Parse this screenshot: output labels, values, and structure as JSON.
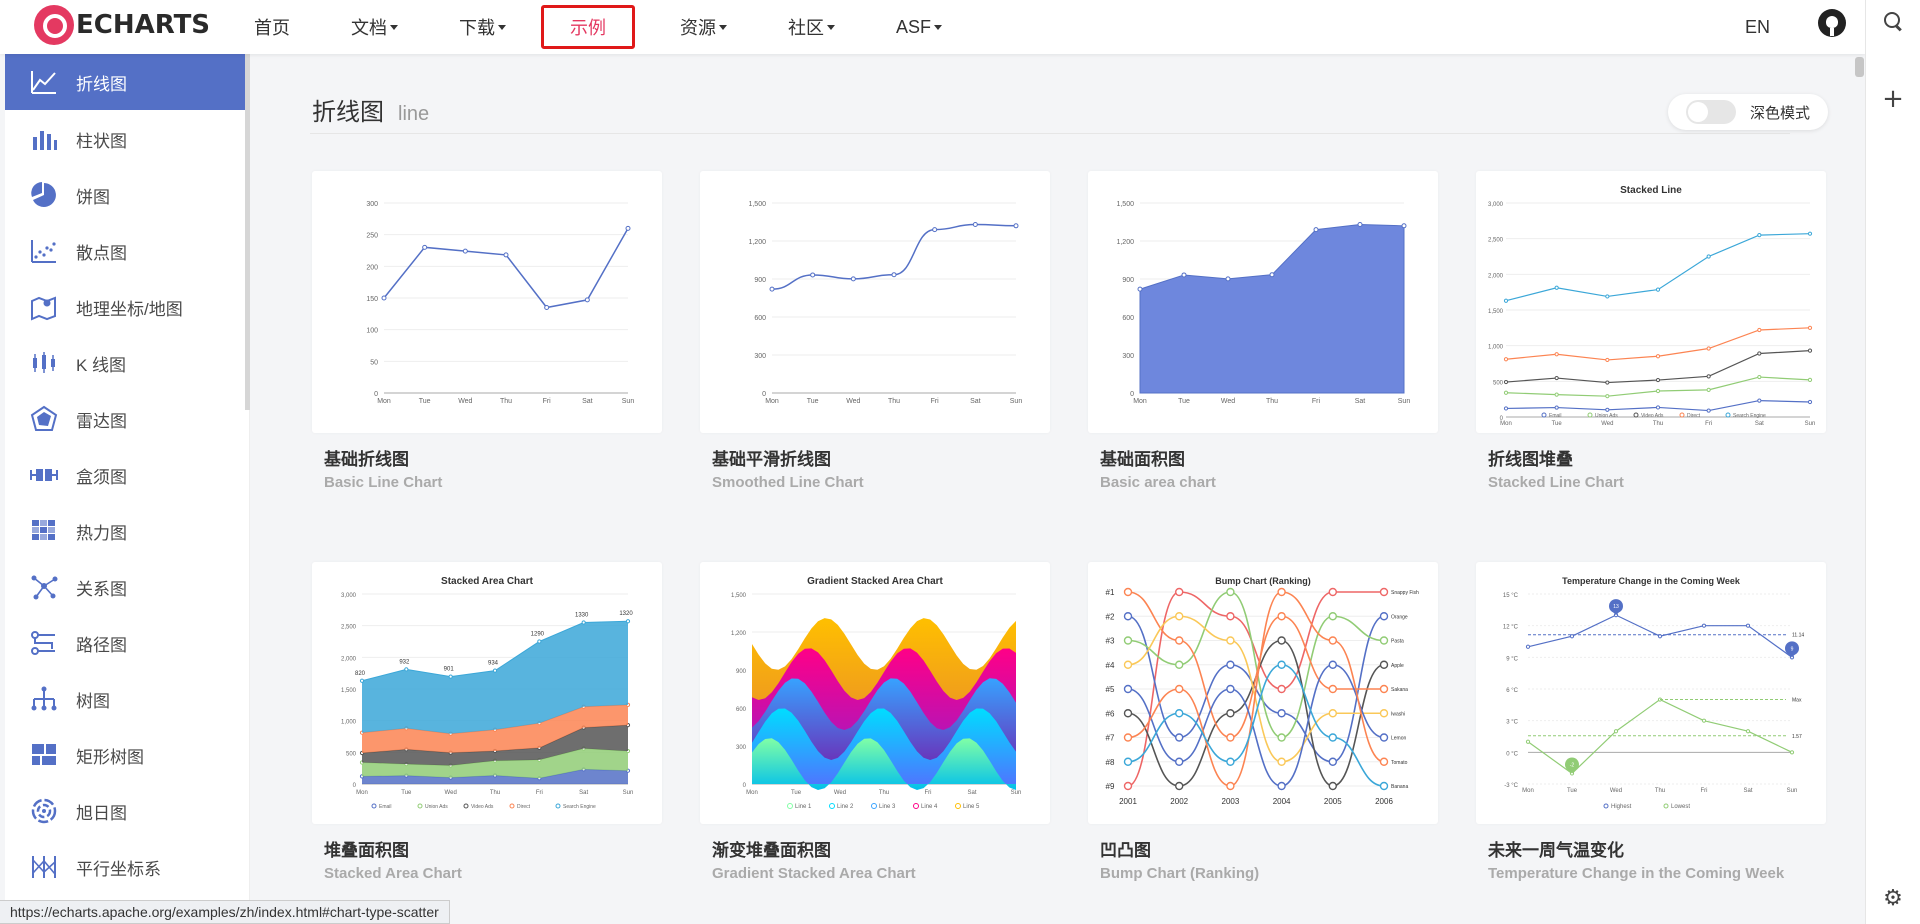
{
  "nav": {
    "logo_text": "ECHARTS",
    "items": [
      {
        "label": "首页",
        "caret": false
      },
      {
        "label": "文档",
        "caret": true
      },
      {
        "label": "下载",
        "caret": true
      },
      {
        "label": "示例",
        "caret": false,
        "active": true
      },
      {
        "label": "资源",
        "caret": true
      },
      {
        "label": "社区",
        "caret": true
      },
      {
        "label": "ASF",
        "caret": true
      }
    ],
    "lang": "EN"
  },
  "sidebar": {
    "items": [
      {
        "label": "折线图",
        "icon": "line-chart-icon",
        "active": true
      },
      {
        "label": "柱状图",
        "icon": "bar-chart-icon"
      },
      {
        "label": "饼图",
        "icon": "pie-chart-icon"
      },
      {
        "label": "散点图",
        "icon": "scatter-chart-icon",
        "hover": true
      },
      {
        "label": "地理坐标/地图",
        "icon": "map-icon"
      },
      {
        "label": "K 线图",
        "icon": "candlestick-icon"
      },
      {
        "label": "雷达图",
        "icon": "radar-icon"
      },
      {
        "label": "盒须图",
        "icon": "boxplot-icon"
      },
      {
        "label": "热力图",
        "icon": "heatmap-icon"
      },
      {
        "label": "关系图",
        "icon": "graph-icon"
      },
      {
        "label": "路径图",
        "icon": "lines-icon"
      },
      {
        "label": "树图",
        "icon": "tree-icon"
      },
      {
        "label": "矩形树图",
        "icon": "treemap-icon"
      },
      {
        "label": "旭日图",
        "icon": "sunburst-icon"
      },
      {
        "label": "平行坐标系",
        "icon": "parallel-icon"
      }
    ]
  },
  "main": {
    "title": "折线图",
    "title_sub": "line",
    "dark_mode_label": "深色模式",
    "cards": [
      {
        "title": "基础折线图",
        "subtitle": "Basic Line Chart"
      },
      {
        "title": "基础平滑折线图",
        "subtitle": "Smoothed Line Chart"
      },
      {
        "title": "基础面积图",
        "subtitle": "Basic area chart"
      },
      {
        "title": "折线图堆叠",
        "subtitle": "Stacked Line Chart"
      },
      {
        "title": "堆叠面积图",
        "subtitle": "Stacked Area Chart"
      },
      {
        "title": "渐变堆叠面积图",
        "subtitle": "Gradient Stacked Area Chart"
      },
      {
        "title": "凹凸图",
        "subtitle": "Bump Chart (Ranking)"
      },
      {
        "title": "未来一周气温变化",
        "subtitle": "Temperature Change in the Coming Week"
      }
    ]
  },
  "status_url": "https://echarts.apache.org/examples/zh/index.html#chart-type-scatter",
  "colors": {
    "accent": "#5470c6",
    "brand": "#e43961",
    "active_border": "#e01818"
  },
  "thumbnails": {
    "days": [
      "Mon",
      "Tue",
      "Wed",
      "Thu",
      "Fri",
      "Sat",
      "Sun"
    ],
    "basic_line": {
      "ticks": [
        "300",
        "250",
        "200",
        "150",
        "100",
        "50",
        "0"
      ],
      "values": [
        150,
        230,
        224,
        218,
        135,
        147,
        260
      ],
      "max": 300
    },
    "smooth_line": {
      "ticks": [
        "1,500",
        "1,200",
        "900",
        "600",
        "300",
        "0"
      ],
      "values": [
        820,
        932,
        901,
        934,
        1290,
        1330,
        1320
      ],
      "max": 1500
    },
    "basic_area": {
      "ticks": [
        "1,500",
        "1,200",
        "900",
        "600",
        "300",
        "0"
      ],
      "values": [
        820,
        932,
        901,
        934,
        1290,
        1330,
        1320
      ],
      "max": 1500
    },
    "stacked_line": {
      "title": "Stacked Line",
      "ticks": [
        "3,000",
        "2,500",
        "2,000",
        "1,500",
        "1,000",
        "500",
        "0"
      ],
      "max": 3000,
      "series": [
        {
          "name": "Email",
          "color": "#5470c6",
          "values": [
            120,
            132,
            101,
            134,
            90,
            230,
            210
          ]
        },
        {
          "name": "Union Ads",
          "color": "#91cc75",
          "values": [
            340,
            314,
            292,
            364,
            380,
            560,
            520
          ]
        },
        {
          "name": "Video Ads",
          "color": "#555555",
          "values": [
            490,
            546,
            483,
            518,
            570,
            890,
            930
          ]
        },
        {
          "name": "Direct",
          "color": "#fc8452",
          "values": [
            810,
            880,
            800,
            852,
            960,
            1220,
            1250
          ]
        },
        {
          "name": "Search Engine",
          "color": "#3ba7d8",
          "values": [
            1630,
            1812,
            1690,
            1786,
            2250,
            2550,
            2570
          ]
        }
      ]
    },
    "stacked_area": {
      "title": "Stacked Area Chart",
      "ticks": [
        "3,000",
        "2,500",
        "2,000",
        "1,500",
        "1,000",
        "500",
        "0"
      ],
      "max": 3000,
      "top_labels": [
        "820",
        "932",
        "901",
        "934",
        "1290",
        "1330",
        "1320"
      ],
      "series": [
        {
          "name": "Email",
          "color": "#5470c6",
          "values": [
            120,
            132,
            101,
            134,
            90,
            230,
            210
          ]
        },
        {
          "name": "Union Ads",
          "color": "#91cc75",
          "values": [
            220,
            182,
            191,
            234,
            290,
            330,
            310
          ]
        },
        {
          "name": "Video Ads",
          "color": "#555555",
          "values": [
            150,
            232,
            201,
            154,
            190,
            330,
            410
          ]
        },
        {
          "name": "Direct",
          "color": "#fc8452",
          "values": [
            320,
            332,
            301,
            334,
            390,
            330,
            320
          ]
        },
        {
          "name": "Search Engine",
          "color": "#3ba7d8",
          "values": [
            820,
            932,
            901,
            934,
            1290,
            1330,
            1320
          ]
        }
      ]
    },
    "gradient_area": {
      "title": "Gradient Stacked Area Chart",
      "ticks": [
        "1,500",
        "1,200",
        "900",
        "600",
        "300",
        "0"
      ],
      "legend": [
        {
          "name": "Line 1",
          "color": "#80ffa5"
        },
        {
          "name": "Line 2",
          "color": "#00ddff"
        },
        {
          "name": "Line 3",
          "color": "#37a2ff"
        },
        {
          "name": "Line 4",
          "color": "#ff0087"
        },
        {
          "name": "Line 5",
          "color": "#ffbf00"
        }
      ]
    },
    "bump": {
      "title": "Bump Chart (Ranking)",
      "ranks": [
        "#1",
        "#2",
        "#3",
        "#4",
        "#5",
        "#6",
        "#7",
        "#8",
        "#9"
      ],
      "years": [
        "2001",
        "2002",
        "2003",
        "2004",
        "2005",
        "2006"
      ],
      "names": [
        "Snappy Fish",
        "Orange",
        "Pasta",
        "Apple",
        "Sakana",
        "Iwashi",
        "Lemon",
        "Tomato",
        "Banana"
      ],
      "colors": [
        "#ee6666",
        "#5470c6",
        "#91cc75",
        "#555555",
        "#fc8452",
        "#fac858",
        "#5470c6",
        "#fc8452",
        "#3ba7d8"
      ],
      "series": [
        [
          9,
          1,
          2,
          5,
          1,
          1
        ],
        [
          2,
          7,
          4,
          6,
          8,
          2
        ],
        [
          3,
          4,
          1,
          7,
          2,
          3
        ],
        [
          6,
          9,
          6,
          3,
          9,
          4
        ],
        [
          1,
          3,
          7,
          2,
          5,
          5
        ],
        [
          4,
          2,
          3,
          8,
          6,
          6
        ],
        [
          5,
          8,
          5,
          9,
          4,
          7
        ],
        [
          7,
          5,
          9,
          1,
          3,
          8
        ],
        [
          8,
          6,
          8,
          4,
          7,
          9
        ]
      ]
    },
    "temperature": {
      "title": "Temperature Change in the Coming Week",
      "ticks": [
        "15 °C",
        "12 °C",
        "9 °C",
        "6 °C",
        "3 °C",
        "0 °C",
        "-3 °C"
      ],
      "high": {
        "name": "Highest",
        "color": "#5470c6",
        "values": [
          10,
          11,
          13,
          11,
          12,
          12,
          9
        ]
      },
      "low": {
        "name": "Lowest",
        "color": "#91cc75",
        "values": [
          1,
          -2,
          2,
          5,
          3,
          2,
          0
        ]
      },
      "max_label_high": "13",
      "min_label_high": "9",
      "min_label_low": "-2",
      "avg_high": "11.14",
      "avg_low": "1.57",
      "max_mark": "Max"
    }
  }
}
